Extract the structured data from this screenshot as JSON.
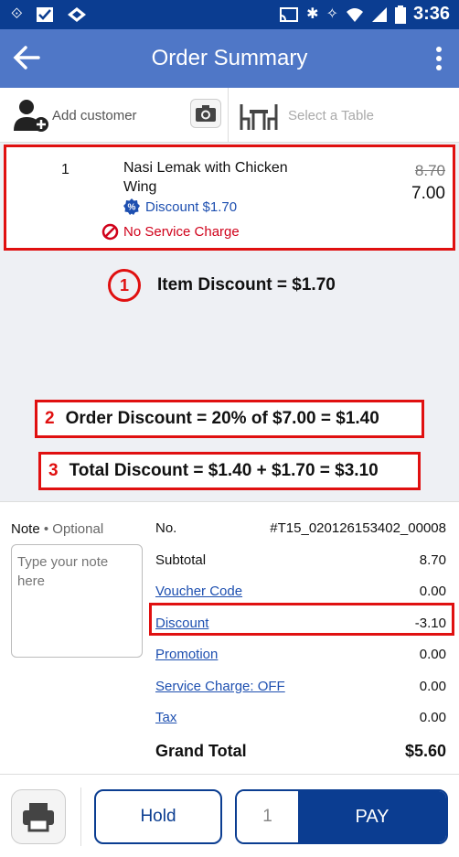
{
  "status_bar": {
    "time": "3:36"
  },
  "app_bar": {
    "title": "Order Summary"
  },
  "customer_row": {
    "add_customer_label": "Add customer",
    "select_table_label": "Select a Table"
  },
  "item": {
    "qty": "1",
    "name": "Nasi Lemak with Chicken Wing",
    "discount_label": "Discount $1.70",
    "no_service_label": "No Service Charge",
    "original_price": "8.70",
    "final_price": "7.00"
  },
  "annotations": {
    "a1_number": "1",
    "a1_text": "Item Discount = $1.70",
    "a2_number": "2",
    "a2_text": "Order Discount = 20% of $7.00 = $1.40",
    "a3_number": "3",
    "a3_text": "Total Discount = $1.40 + $1.70 = $3.10",
    "highlight_color": "#e01010"
  },
  "note": {
    "label": "Note",
    "optional": "Optional",
    "placeholder": "Type your note here"
  },
  "summary": {
    "rows": [
      {
        "label": "No.",
        "value": "#T15_020126153402_00008"
      },
      {
        "label": "Subtotal",
        "value": "8.70"
      },
      {
        "label": "Voucher Code",
        "value": "0.00"
      },
      {
        "label": "Discount",
        "value": "-3.10"
      },
      {
        "label": "Promotion",
        "value": "0.00"
      },
      {
        "label": "Service Charge: OFF",
        "value": "0.00"
      },
      {
        "label": "Tax",
        "value": "0.00"
      },
      {
        "label": "Grand Total",
        "value": "$5.60"
      }
    ]
  },
  "bottom_bar": {
    "hold_label": "Hold",
    "pay_qty": "1",
    "pay_label": "PAY"
  },
  "colors": {
    "primary": "#0b3d91",
    "appbar": "#4f77c7",
    "link": "#1d4fb0",
    "danger": "#d0021b"
  }
}
